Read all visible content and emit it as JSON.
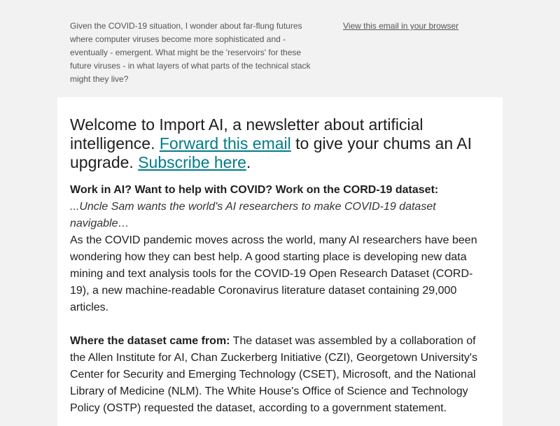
{
  "preheader": {
    "text": "Given the COVID-19 situation, I wonder about far-flung futures where computer viruses become more sophisticated and - eventually - emergent. What might be the 'reservoirs' for these future viruses - in what layers of what parts of the technical stack might they live?",
    "view_in_browser": "View this email in your browser"
  },
  "intro": {
    "part1": "Welcome to Import AI, a newsletter about artificial intelligence. ",
    "forward_link": "Forward this email",
    "part2": " to give your chums an AI upgrade. ",
    "subscribe_link": "Subscribe here",
    "part3": "."
  },
  "article": {
    "heading": "Work in AI? Want to help with COVID? Work on the CORD-19 dataset:",
    "subheading": "...Uncle Sam wants the world's AI researchers to make COVID-19 dataset navigable…",
    "paragraph1": "As the COVID pandemic moves across the world, many AI researchers have been wondering how they can best help. A good starting place is developing new data mining and text analysis tools for the COVID-19 Open Research Dataset (CORD-19), a new machine-readable Coronavirus literature dataset containing 29,000 articles.",
    "source_label": "Where the dataset came from:",
    "source_text": "  The dataset was assembled by a collaboration of the Allen Institute for AI, Chan Zuckerberg Initiative (CZI), Georgetown University's Center for Security and Emerging Technology (CSET), Microsoft, and the National Library of Medicine (NLM). The White House's Office of Science and Technology Policy (OSTP) requested the dataset, according to a government statement."
  }
}
